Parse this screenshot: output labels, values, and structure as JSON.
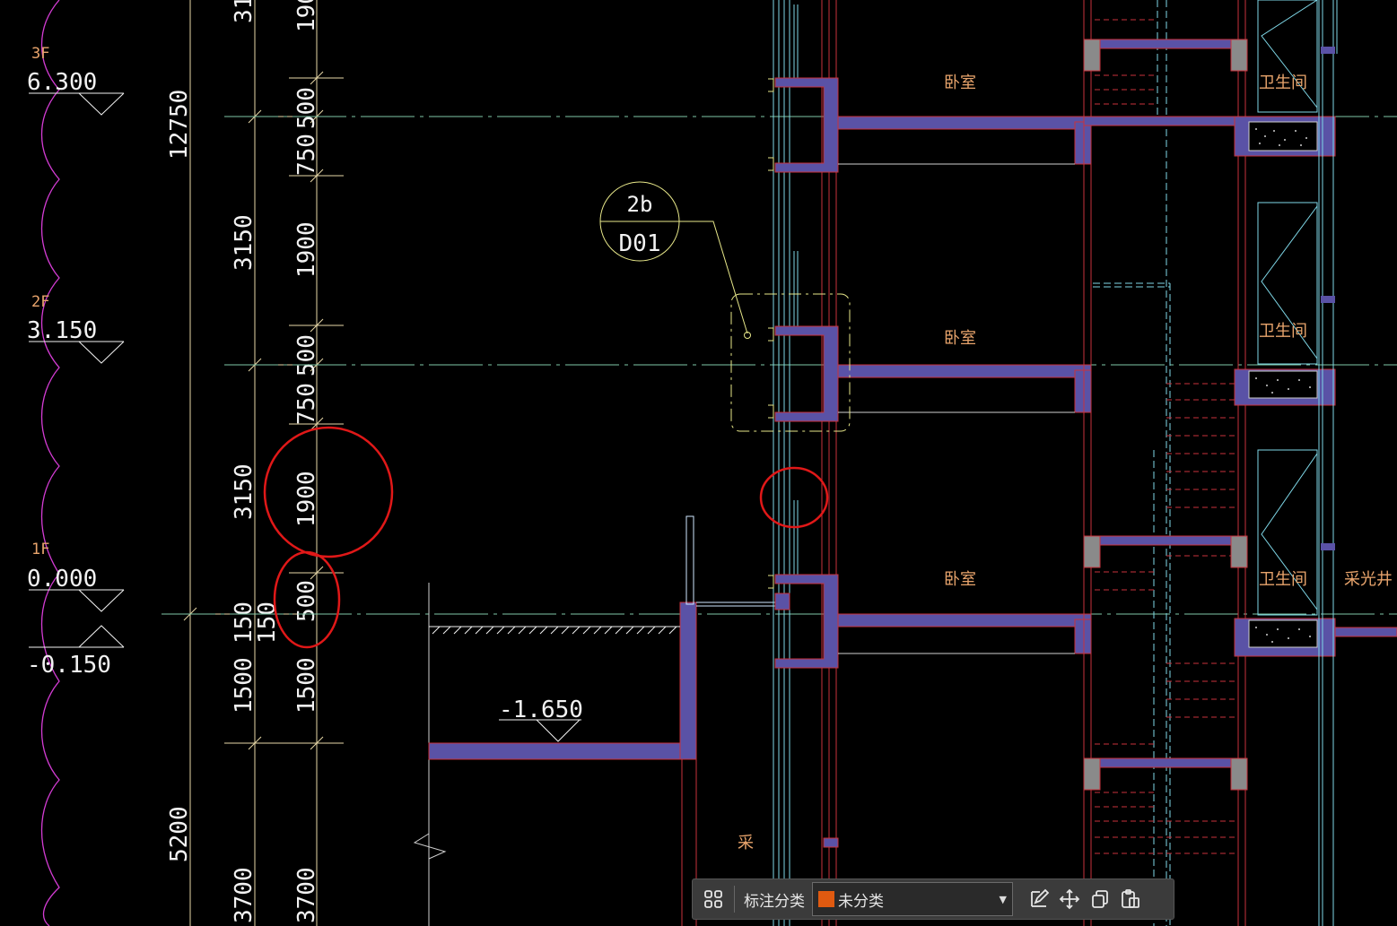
{
  "drawing": {
    "colors": {
      "background": "#000000",
      "wall_fill": "#5a52a6",
      "wall_edge": "#c8323c",
      "dim_line": "#f2f2d0",
      "dim_text": "#f2f2f2",
      "grid_line": "#7fc8a8",
      "magenta": "#d43cd4",
      "cyan": "#7fd8e8",
      "label": "#e8a46c",
      "yellow": "#e8e88a",
      "markup": "#e01818",
      "gray_block": "#8a8a8a"
    },
    "levels": [
      {
        "name": "3F",
        "elevation": "6.300"
      },
      {
        "name": "2F",
        "elevation": "3.150"
      },
      {
        "name": "1F",
        "elevation": "0.000"
      },
      {
        "name": "",
        "elevation": "-0.150"
      }
    ],
    "pit_elevation": "-1.650",
    "outer_dims": [
      "12750",
      "5200"
    ],
    "middle_dims": [
      "31",
      "3150",
      "3150",
      "150",
      "1500",
      "3700"
    ],
    "inner_dims": [
      "190",
      "500",
      "750",
      "1900",
      "500",
      "750",
      "1900",
      "500",
      "150",
      "1500",
      "3700"
    ],
    "detail_callout": {
      "number": "2b",
      "sheet": "D01"
    },
    "room_labels": {
      "bedroom": "卧室",
      "bathroom": "卫生间",
      "lightwell": "采光井",
      "partial": "采"
    }
  },
  "toolbar": {
    "grid_icon": "grid-icon",
    "label": "标注分类",
    "select_value": "未分类",
    "swatch_color": "#e05a10",
    "edit_icon": "edit-icon",
    "move_icon": "move-icon",
    "copy_icon": "copy-icon",
    "paste_icon": "paste-icon"
  }
}
